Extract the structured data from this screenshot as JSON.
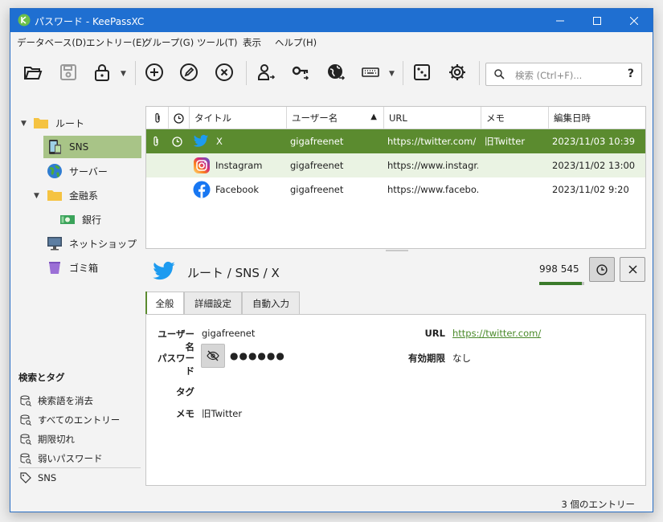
{
  "window": {
    "title": "パスワード - KeePassXC",
    "controls": [
      "minimize",
      "maximize",
      "close"
    ]
  },
  "menu": [
    "データベース(D)",
    "エントリー(E)",
    "グループ(G)",
    "ツール(T)",
    "表示",
    "ヘルプ(H)"
  ],
  "toolbar": {
    "buttons": [
      "open-database",
      "save-database",
      "lock-database",
      "add-entry",
      "edit-entry",
      "delete-entry",
      "copy-username",
      "copy-password",
      "copy-url",
      "autotype",
      "password-generator",
      "settings"
    ],
    "search_placeholder": "検索 (Ctrl+F)...",
    "search_help": "?"
  },
  "groups": [
    {
      "label": "ルート",
      "icon": "folder-icon",
      "expanded": true
    },
    {
      "label": "SNS",
      "icon": "phone-icon",
      "selected": true
    },
    {
      "label": "サーバー",
      "icon": "globe-icon"
    },
    {
      "label": "金融系",
      "icon": "folder-icon",
      "expanded": true
    },
    {
      "label": "銀行",
      "icon": "money-icon"
    },
    {
      "label": "ネットショップ",
      "icon": "monitor-icon"
    },
    {
      "label": "ゴミ箱",
      "icon": "trash-icon"
    }
  ],
  "tags_section": {
    "title": "検索とタグ",
    "items": [
      "検索語を消去",
      "すべてのエントリー",
      "期限切れ",
      "弱いパスワード"
    ],
    "tags": [
      "SNS"
    ]
  },
  "entries": {
    "columns": [
      "",
      "",
      "タイトル",
      "ユーザー名",
      "URL",
      "メモ",
      "編集日時"
    ],
    "sort_column": "ユーザー名",
    "rows": [
      {
        "title": "X",
        "username": "gigafreenet",
        "url": "https://twitter.com/",
        "notes": "旧Twitter",
        "modified": "2023/11/03 10:39",
        "icon": "twitter-icon",
        "selected": true
      },
      {
        "title": "Instagram",
        "username": "gigafreenet",
        "url": "https://www.instagr...",
        "notes": "",
        "modified": "2023/11/02 13:00",
        "icon": "instagram-icon"
      },
      {
        "title": "Facebook",
        "username": "gigafreenet",
        "url": "https://www.facebo...",
        "notes": "",
        "modified": "2023/11/02 9:20",
        "icon": "facebook-icon"
      }
    ]
  },
  "preview": {
    "path": "ルート / SNS / X",
    "totp": "998 545",
    "totp_remaining_fraction": 0.95,
    "tabs": [
      "全般",
      "詳細設定",
      "自動入力"
    ],
    "active_tab": "全般",
    "fields": {
      "username_label": "ユーザー名",
      "username": "gigafreenet",
      "password_label": "パスワード",
      "password": "●●●●●●",
      "tags_label": "タグ",
      "notes_label": "メモ",
      "notes": "旧Twitter",
      "url_label": "URL",
      "url": "https://twitter.com/",
      "expiry_label": "有効期限",
      "expiry": "なし"
    }
  },
  "status": "3 個のエントリー",
  "colors": {
    "titlebar": "#1f6fd1",
    "selection": "#5b8b2f",
    "group_selection": "#a8c487",
    "link": "#4a8a2a"
  }
}
